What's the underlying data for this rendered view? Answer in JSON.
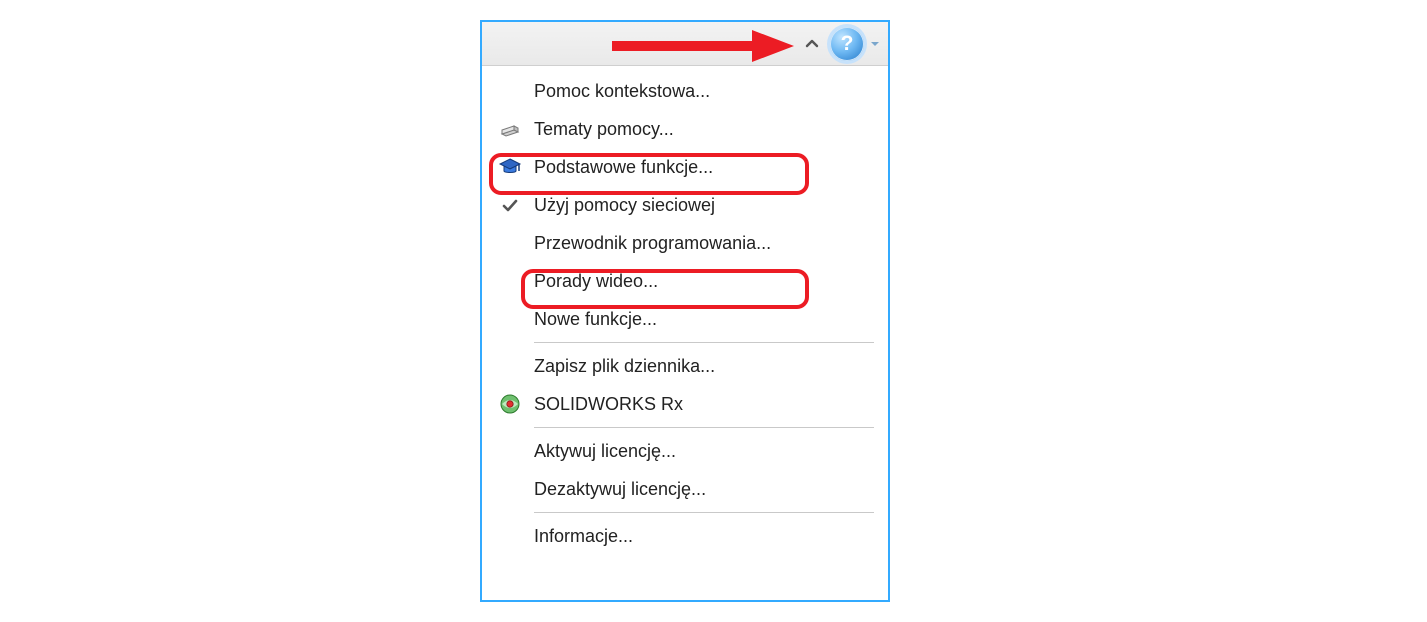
{
  "toolbar": {
    "collapse_tooltip": "Collapse",
    "help_tooltip": "Help",
    "dropdown_tooltip": "Help menu"
  },
  "menu": {
    "items": [
      {
        "icon": "",
        "label": "Pomoc kontekstowa..."
      },
      {
        "icon": "book",
        "label": "Tematy pomocy..."
      },
      {
        "icon": "grad-cap",
        "label": "Podstawowe funkcje...",
        "highlighted": true
      },
      {
        "icon": "check",
        "label": "Użyj pomocy sieciowej"
      },
      {
        "icon": "",
        "label": "Przewodnik programowania..."
      },
      {
        "icon": "",
        "label": "Porady wideo...",
        "highlighted": true
      },
      {
        "icon": "",
        "label": "Nowe funkcje..."
      },
      {
        "separator": true
      },
      {
        "icon": "",
        "label": "Zapisz plik dziennika..."
      },
      {
        "icon": "globe-rx",
        "label": "SOLIDWORKS Rx"
      },
      {
        "separator": true
      },
      {
        "icon": "",
        "label": "Aktywuj licencję..."
      },
      {
        "icon": "",
        "label": "Dezaktywuj licencję..."
      },
      {
        "separator": true
      },
      {
        "icon": "",
        "label": "Informacje..."
      }
    ]
  }
}
